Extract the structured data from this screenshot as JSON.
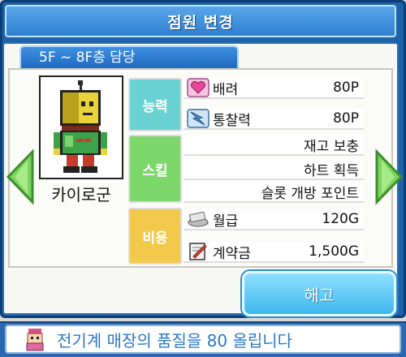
{
  "title": "점원 변경",
  "floor_tab": "5F ~ 8F층 담당",
  "character": {
    "name": "카이로군"
  },
  "sections": {
    "ability": {
      "label": "능력",
      "color": "#69d3d3",
      "rows": [
        {
          "icon": "heart-icon",
          "label": "배려",
          "value": "80P"
        },
        {
          "icon": "lightning-icon",
          "label": "통찰력",
          "value": "80P"
        }
      ]
    },
    "skill": {
      "label": "스킬",
      "color": "#7dd76b",
      "rows": [
        "재고 보충",
        "하트 획득",
        "슬롯 개방 포인트"
      ]
    },
    "cost": {
      "label": "비용",
      "color": "#f2c94a",
      "rows": [
        {
          "icon": "money-icon",
          "label": "월급",
          "value": "120G"
        },
        {
          "icon": "contract-icon",
          "label": "계약금",
          "value": "1,500G"
        }
      ]
    }
  },
  "fire_button": "해고",
  "tip": {
    "icon": "advisor-icon",
    "text": "전기계 매장의 품질을 80 올립니다"
  },
  "colors": {
    "accent": "#2a69b0",
    "arrow": "#7cd35f",
    "tip_text": "#2b78c8"
  }
}
